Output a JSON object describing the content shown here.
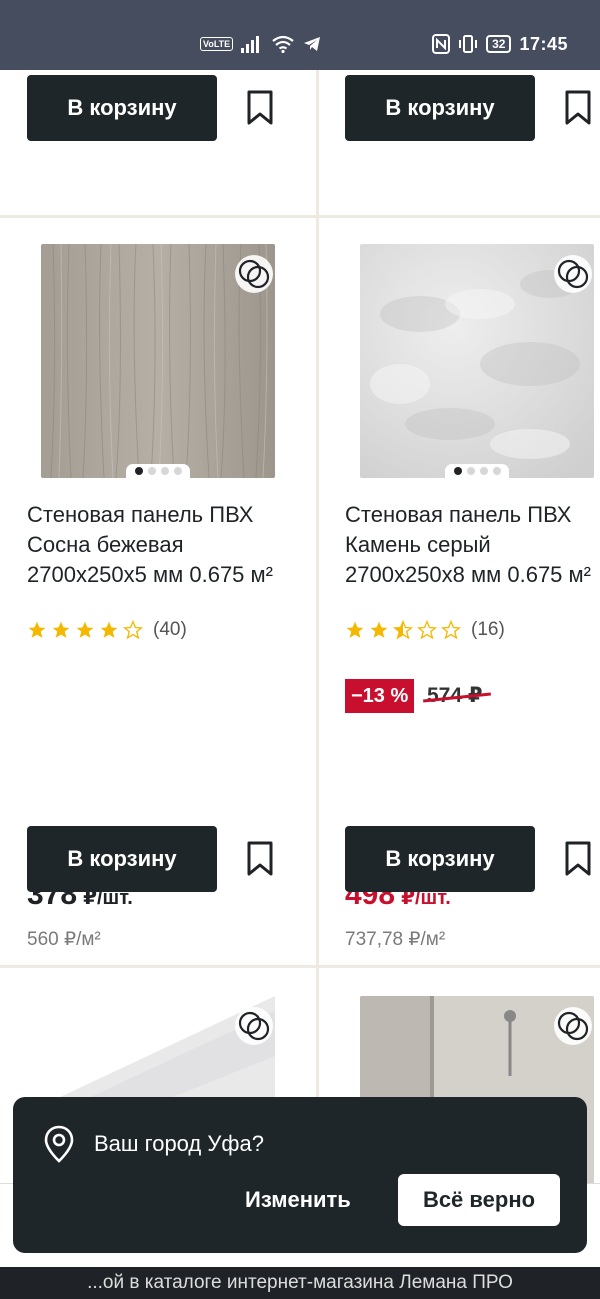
{
  "status_bar": {
    "volte": "VoLTE",
    "battery": "32",
    "time": "17:45"
  },
  "products": [
    {
      "cart_label": "В корзину"
    },
    {
      "cart_label": "В корзину"
    },
    {
      "title": "Стеновая панель ПВХ Сосна бежевая 2700x250x5 мм 0.675 м²",
      "rating": 4,
      "reviews": "(40)",
      "price": "378",
      "price_unit": "₽/шт.",
      "unit_price": "560 ₽/м²",
      "cart_label": "В корзину",
      "image_dots": 4,
      "image_dot_active": 1
    },
    {
      "title": "Стеновая панель ПВХ Камень серый 2700x250x8 мм 0.675 м²",
      "rating": 2.5,
      "reviews": "(16)",
      "discount": "−13 %",
      "old_price": "574 ₽",
      "price": "498",
      "price_unit": "₽/шт.",
      "unit_price": "737,78 ₽/м²",
      "cart_label": "В корзину",
      "image_dots": 4,
      "image_dot_active": 1
    }
  ],
  "city_popup": {
    "question": "Ваш город Уфа?",
    "change_label": "Изменить",
    "confirm_label": "Всё верно"
  },
  "footer": {
    "text": "...ой в каталоге интернет-магазина Лемана ПРО"
  },
  "colors": {
    "accent_red": "#c8102e",
    "button_dark": "#1f2629",
    "star": "#f5b800"
  }
}
